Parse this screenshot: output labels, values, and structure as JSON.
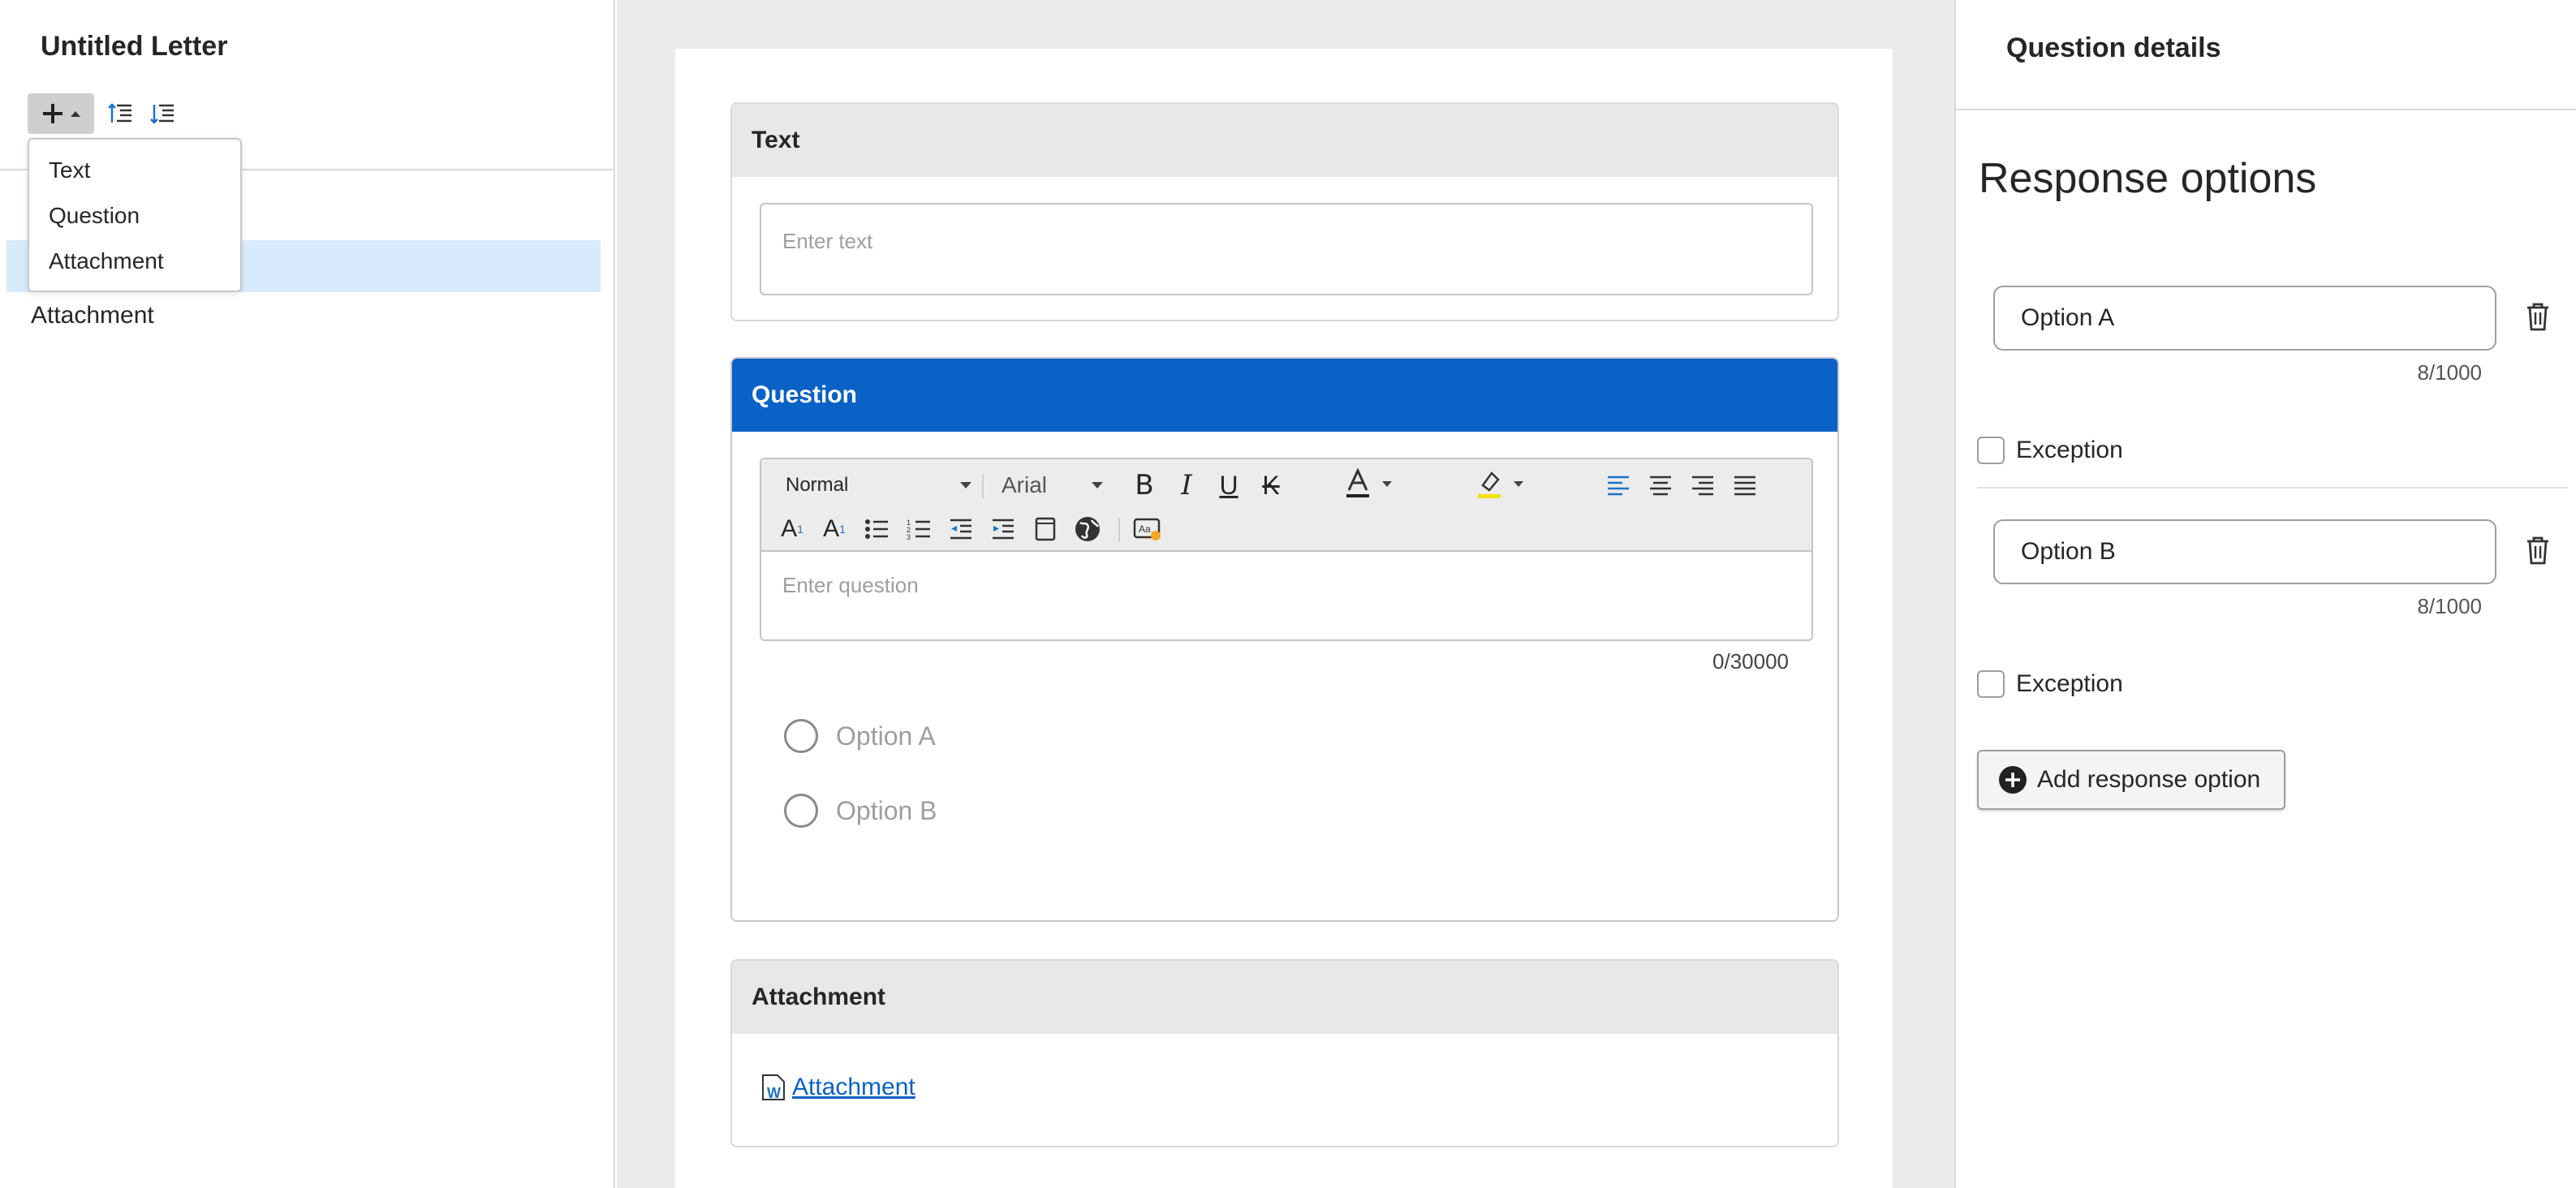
{
  "left_panel": {
    "title": "Untitled Letter",
    "add_menu": [
      "Text",
      "Question",
      "Attachment"
    ],
    "outline_items": [
      "Attachment"
    ]
  },
  "canvas": {
    "text_block": {
      "title": "Text",
      "placeholder": "Enter text"
    },
    "question_block": {
      "title": "Question",
      "style_select": "Normal",
      "font_select": "Arial",
      "placeholder": "Enter question",
      "counter": "0/30000",
      "options": [
        "Option A",
        "Option B"
      ]
    },
    "attachment_block": {
      "title": "Attachment",
      "link": "Attachment"
    }
  },
  "right_panel": {
    "title": "Question details",
    "heading": "Response options",
    "options": [
      {
        "value": "Option A",
        "count": "8/1000",
        "exception_label": "Exception"
      },
      {
        "value": "Option B",
        "count": "8/1000",
        "exception_label": "Exception"
      }
    ],
    "add_button": "Add response option"
  },
  "colors": {
    "accent": "#0a62c6",
    "selected": "#d8ebfd",
    "canvas_bg": "#ebebeb",
    "toolbar_bg": "#ececec"
  }
}
